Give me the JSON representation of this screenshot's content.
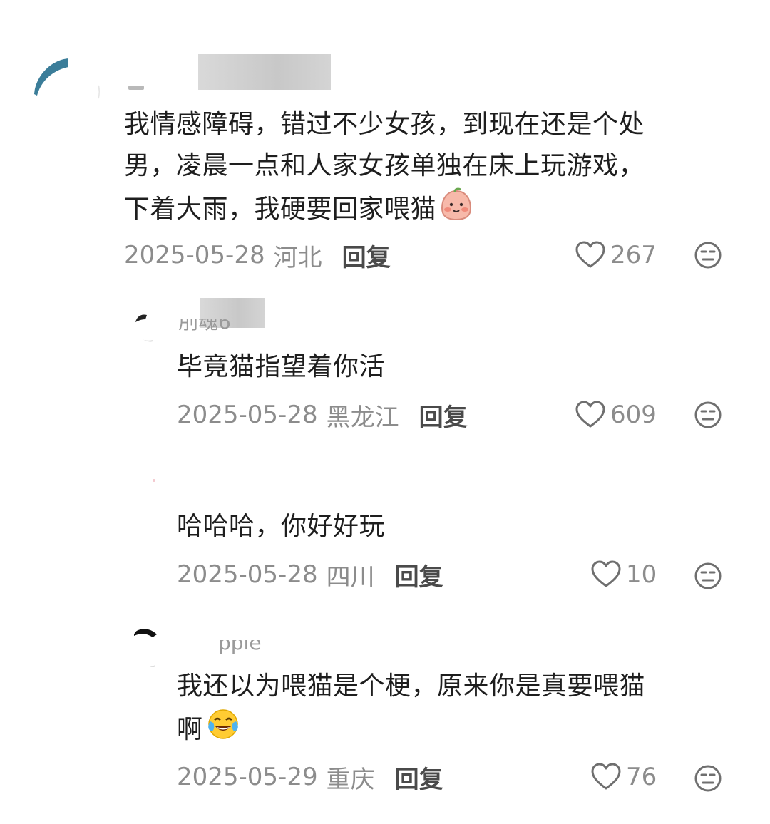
{
  "comments": [
    {
      "text_lines": [
        "我情感障碍，错过不少女孩，到现在还是个处",
        "男，凌晨一点和人家女孩单独在床上玩游戏，",
        "下着大雨，我硬要回家喂猫"
      ],
      "emoji": "blush-face-emoji",
      "date": "2025-05-28",
      "region": "河北",
      "reply_label": "回复",
      "likes": "267"
    },
    {
      "username_partial": "刖魂6",
      "text_lines": [
        "毕竟猫指望着你活"
      ],
      "date": "2025-05-28",
      "region": "黑龙江",
      "reply_label": "回复",
      "likes": "609"
    },
    {
      "text_lines": [
        "哈哈哈，你好好玩"
      ],
      "date": "2025-05-28",
      "region": "四川",
      "reply_label": "回复",
      "likes": "10"
    },
    {
      "username_partial": "pple",
      "text_lines": [
        "我还以为喂猫是个梗，原来你是真要喂猫",
        "啊"
      ],
      "emoji": "laughing-tears-emoji",
      "date": "2025-05-29",
      "region": "重庆",
      "reply_label": "回复",
      "likes": "76"
    }
  ],
  "colors": {
    "text": "#1e1e1e",
    "meta": "#8c8c8c",
    "reply": "#4a4a4a",
    "avatar_accent": "#3b7d99"
  },
  "icons": [
    "heart-outline-icon",
    "dislike-face-icon"
  ]
}
